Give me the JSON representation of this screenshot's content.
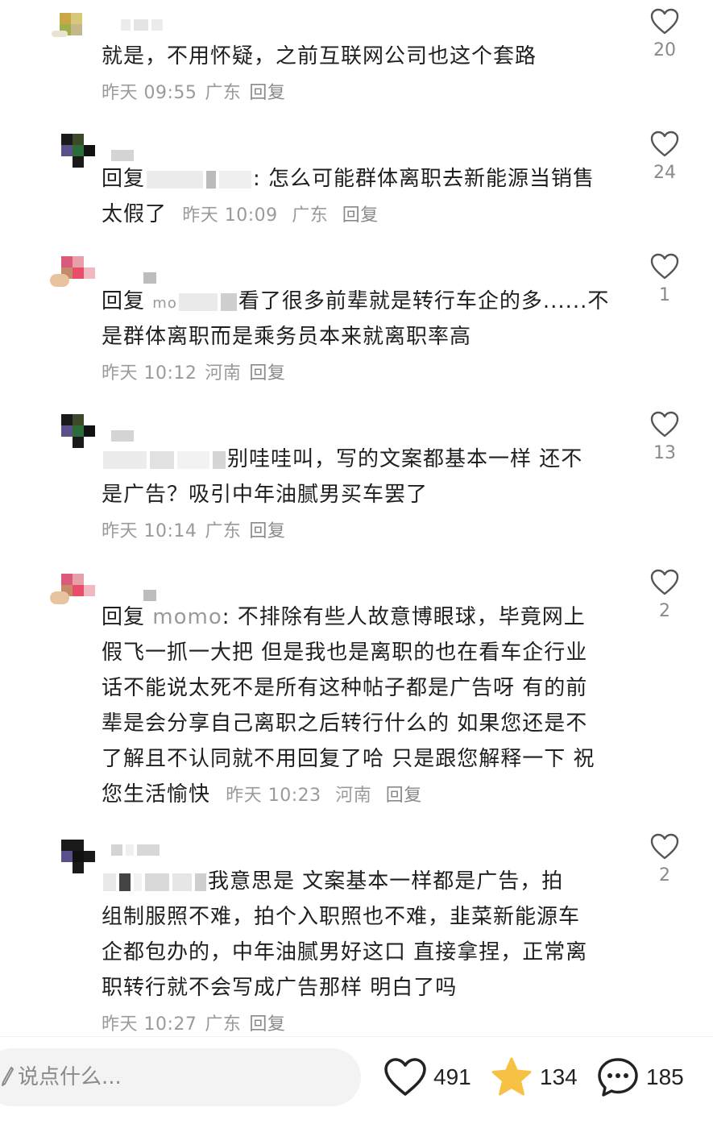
{
  "comments": [
    {
      "text": "就是，不用怀疑，之前互联网公司也这个套路",
      "time": "昨天 09:55",
      "location": "广东",
      "reply_label": "回复",
      "likes": "20"
    },
    {
      "reply_prefix": "回复",
      "text": ": 怎么可能群体离职去新能源当销售",
      "text_line2": "太假了",
      "time": "昨天 10:09",
      "location": "广东",
      "reply_label": "回复",
      "likes": "24"
    },
    {
      "reply_prefix": "回复",
      "reply_target": "mo",
      "text": "看了很多前辈就是转行车企的多......不",
      "text_line2": "是群体离职而是乘务员本来就离职率高",
      "time": "昨天 10:12",
      "location": "河南",
      "reply_label": "回复",
      "likes": "1"
    },
    {
      "text": "别哇哇叫，写的文案都基本一样 还不",
      "text_line2": "是广告？吸引中年油腻男买车罢了",
      "time": "昨天 10:14",
      "location": "广东",
      "reply_label": "回复",
      "likes": "13"
    },
    {
      "reply_prefix": "回复",
      "reply_target": "momo",
      "text": ": 不排除有些人故意博眼球，毕竟网上",
      "text_line2": "假飞一抓一大把 但是我也是离职的也在看车企行业",
      "text_line3": "话不能说太死不是所有这种帖子都是广告呀 有的前",
      "text_line4": "辈是会分享自己离职之后转行什么的 如果您还是不",
      "text_line5": "了解且不认同就不用回复了哈 只是跟您解释一下 祝",
      "text_line6": "您生活愉快",
      "time": "昨天 10:23",
      "location": "河南",
      "reply_label": "回复",
      "likes": "2"
    },
    {
      "text": "我意思是 文案基本一样都是广告，拍",
      "text_line2": "组制服照不难，拍个入职照也不难，韭菜新能源车",
      "text_line3": "企都包办的，中年油腻男好这口 直接拿捏，正常离",
      "text_line4": "职转行就不会写成广告那样 明白了吗",
      "time": "昨天 10:27",
      "location": "广东",
      "reply_label": "回复",
      "likes": "2"
    }
  ],
  "bottom_bar": {
    "placeholder": "说点什么...",
    "like_count": "491",
    "star_count": "134",
    "comment_count": "185"
  },
  "colors": {
    "meta_gray": "#9a9a9a",
    "star_yellow": "#f7c244",
    "icon_dark": "#222222"
  }
}
